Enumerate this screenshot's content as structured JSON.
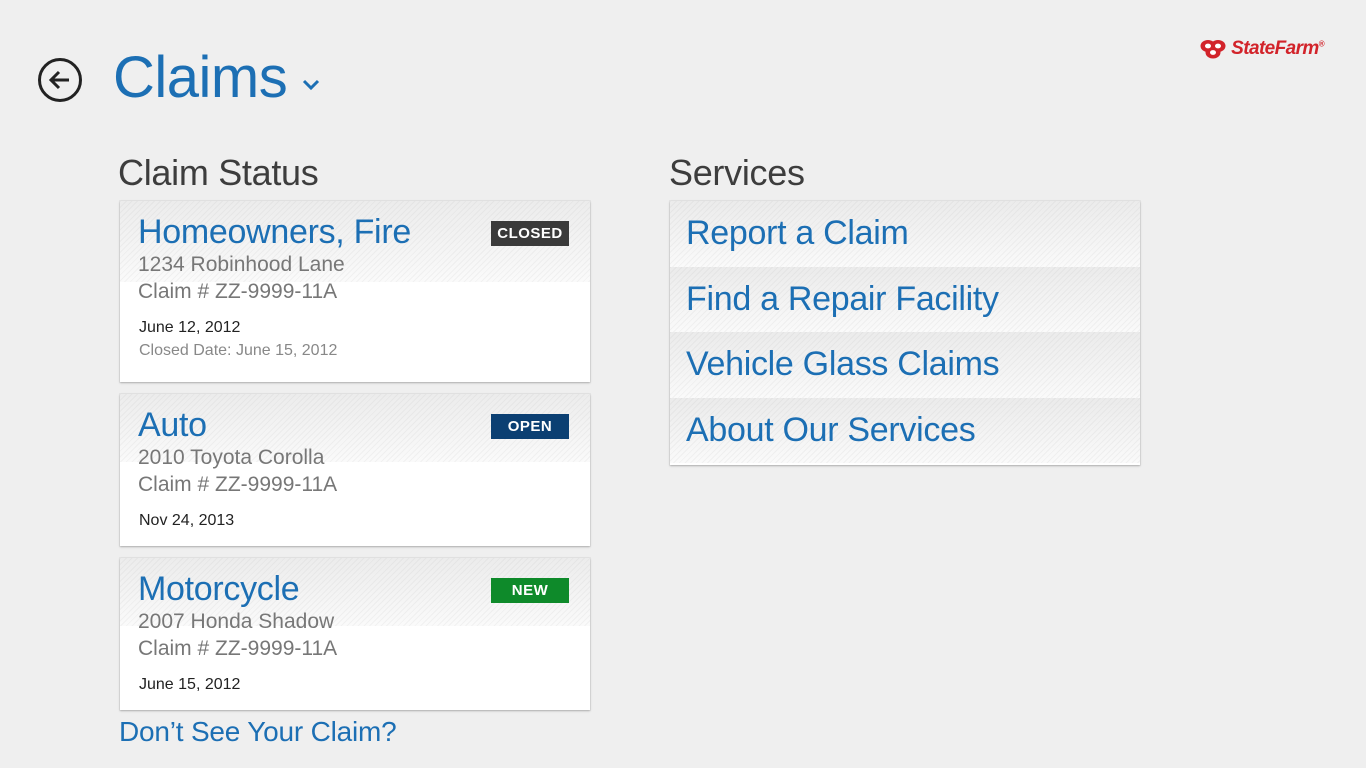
{
  "header": {
    "title": "Claims",
    "logo_text": "StateFarm",
    "logo_reg": "®"
  },
  "claim_status": {
    "heading": "Claim Status",
    "claims": [
      {
        "title": "Homeowners, Fire",
        "badge": "CLOSED",
        "badge_color": "#3a3a3a",
        "address": "1234 Robinhood Lane",
        "claim_number": "Claim # ZZ-9999-11A",
        "date": "June 12, 2012",
        "closed_date": "Closed Date: June 15, 2012"
      },
      {
        "title": "Auto",
        "badge": "OPEN",
        "badge_color": "#0b3f72",
        "address": "2010 Toyota Corolla",
        "claim_number": "Claim # ZZ-9999-11A",
        "date": "Nov 24, 2013"
      },
      {
        "title": "Motorcycle",
        "badge": "NEW",
        "badge_color": "#0e8a2a",
        "address": "2007 Honda Shadow",
        "claim_number": "Claim # ZZ-9999-11A",
        "date": "June 15, 2012"
      }
    ],
    "dont_see_link": "Don’t See Your Claim?"
  },
  "services": {
    "heading": "Services",
    "items": [
      {
        "label": "Report a Claim"
      },
      {
        "label": "Find a Repair Facility"
      },
      {
        "label": "Vehicle Glass Claims"
      },
      {
        "label": "About Our Services"
      }
    ]
  },
  "colors": {
    "accent_blue": "#1c6fb4",
    "brand_red": "#d2232a",
    "background": "#efefef"
  },
  "icons": {
    "back": "back-arrow-circle-icon",
    "title_dropdown": "chevron-down-icon",
    "logo_mark": "state-farm-ovals-icon"
  }
}
